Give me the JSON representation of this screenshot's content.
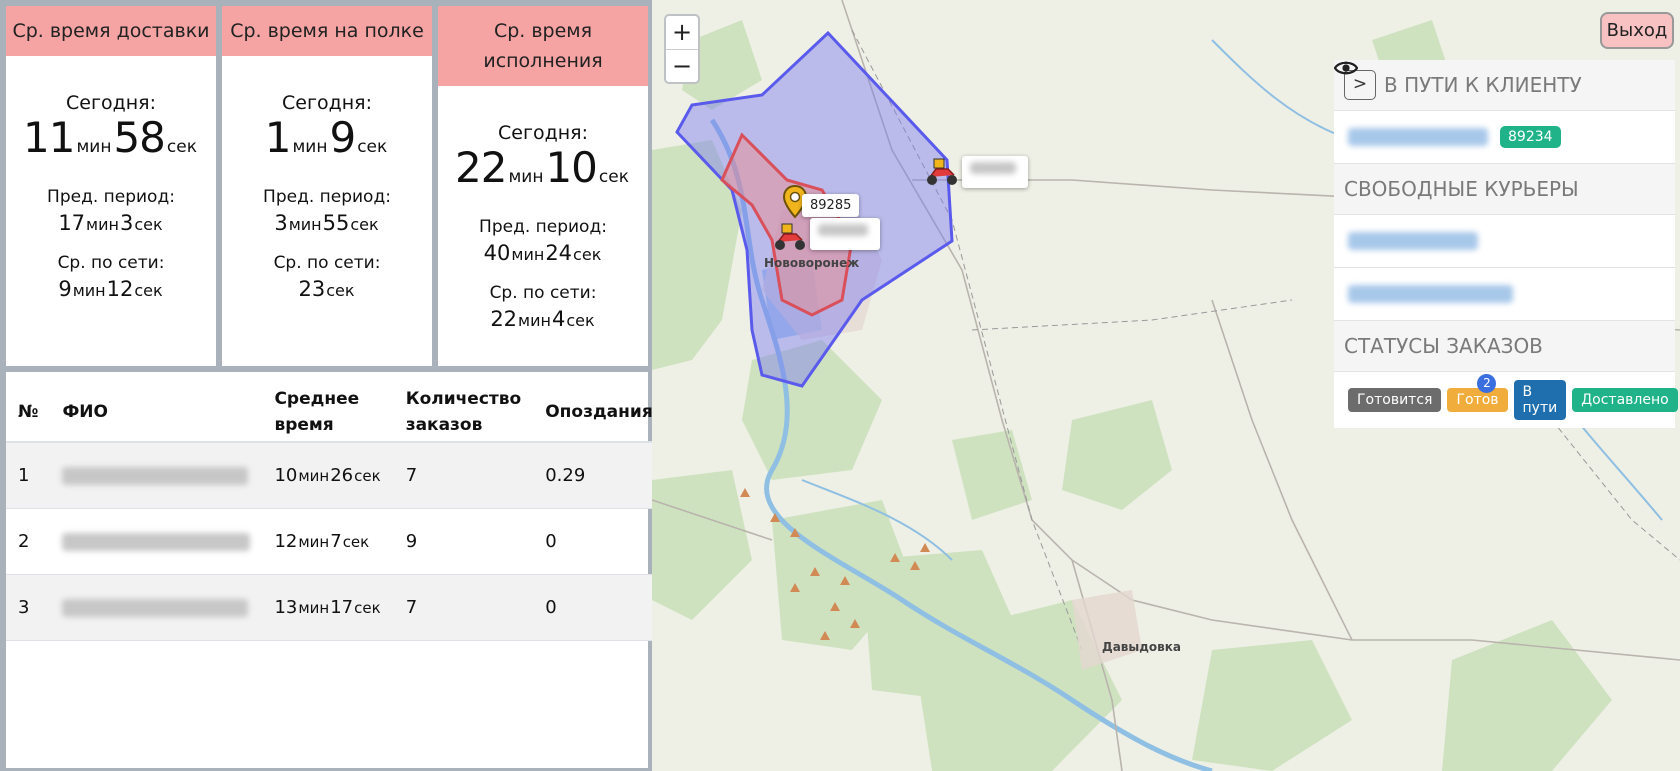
{
  "cards": [
    {
      "title": "Ср. время доставки",
      "today_label": "Сегодня:",
      "today": {
        "min": "11",
        "sec": "58"
      },
      "prev_label": "Пред. период:",
      "prev": {
        "min": "17",
        "sec": "3"
      },
      "net_label": "Ср. по сети:",
      "net": {
        "min": "9",
        "sec": "12"
      }
    },
    {
      "title": "Ср. время на полке",
      "today_label": "Сегодня:",
      "today": {
        "min": "1",
        "sec": "9"
      },
      "prev_label": "Пред. период:",
      "prev": {
        "min": "3",
        "sec": "55"
      },
      "net_label": "Ср. по сети:",
      "net": {
        "sec": "23"
      }
    },
    {
      "title": "Ср. время исполнения",
      "today_label": "Сегодня:",
      "today": {
        "min": "22",
        "sec": "10"
      },
      "prev_label": "Пред. период:",
      "prev": {
        "min": "40",
        "sec": "24"
      },
      "net_label": "Ср. по сети:",
      "net": {
        "min": "22",
        "sec": "4"
      }
    }
  ],
  "units": {
    "min": "мин",
    "sec": "сек"
  },
  "table": {
    "headers": [
      "№",
      "ФИО",
      "Среднее время",
      "Количество заказов",
      "Опоздания"
    ],
    "rows": [
      {
        "n": "1",
        "min": "10",
        "sec": "26",
        "orders": "7",
        "late": "0.29"
      },
      {
        "n": "2",
        "min": "12",
        "sec": "7",
        "orders": "9",
        "late": "0"
      },
      {
        "n": "3",
        "min": "13",
        "sec": "17",
        "orders": "7",
        "late": "0"
      }
    ]
  },
  "map": {
    "zoom_in": "+",
    "zoom_out": "−",
    "exit": "Выход",
    "town_label": "Нововоронеж",
    "village_label": "Давыдовка",
    "marker_popup": "89285"
  },
  "side": {
    "toggle": ">",
    "in_transit_title": "В ПУТИ К КЛИЕНТУ",
    "order_pill": "89234",
    "free_couriers_title": "СВОБОДНЫЕ КУРЬЕРЫ",
    "statuses_title": "СТАТУСЫ ЗАКАЗОВ",
    "statuses": [
      {
        "label": "Готовится",
        "color": "#6c6c6c"
      },
      {
        "label": "Готов",
        "color": "#f0ad3c",
        "badge": "2"
      },
      {
        "label": "В пути",
        "color": "#1f6fae"
      },
      {
        "label": "Доставлено",
        "color": "#20b38a"
      }
    ]
  }
}
